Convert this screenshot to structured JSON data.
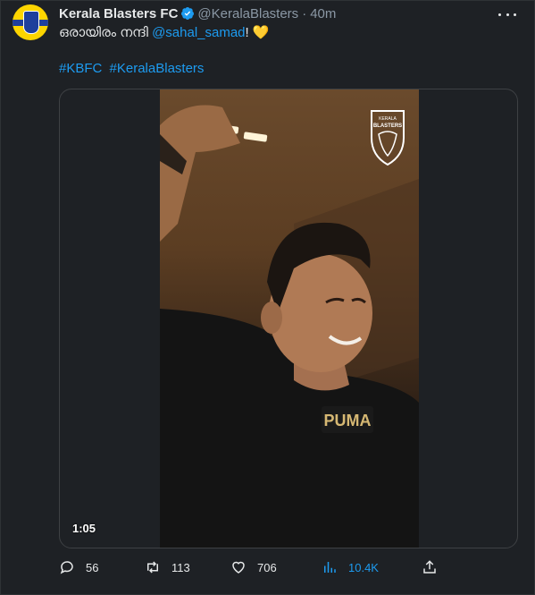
{
  "tweet": {
    "author_name": "Kerala Blasters FC",
    "handle": "@KeralaBlasters",
    "separator": "·",
    "time": "40m",
    "text_prefix": "ഒരായിരം നന്ദി ",
    "mention": "@sahal_samad",
    "text_suffix": "! ",
    "emoji": "💛",
    "hashtags": [
      "#KBFC",
      "#KeralaBlasters"
    ]
  },
  "media": {
    "video_duration": "1:05",
    "crest_text_top": "KERALA",
    "crest_text_bottom": "BLASTERS",
    "shirt_logo_text": "PUMA"
  },
  "actions": {
    "replies": "56",
    "retweets": "113",
    "likes": "706",
    "views": "10.4K"
  },
  "colors": {
    "accent": "#1d9bf0",
    "background": "#1e2125",
    "brand_yellow": "#fdd500",
    "brand_blue": "#1f3f9c"
  },
  "icons": [
    "verified-badge-icon",
    "more-options-icon",
    "reply-icon",
    "retweet-icon",
    "like-icon",
    "views-icon",
    "share-icon"
  ]
}
